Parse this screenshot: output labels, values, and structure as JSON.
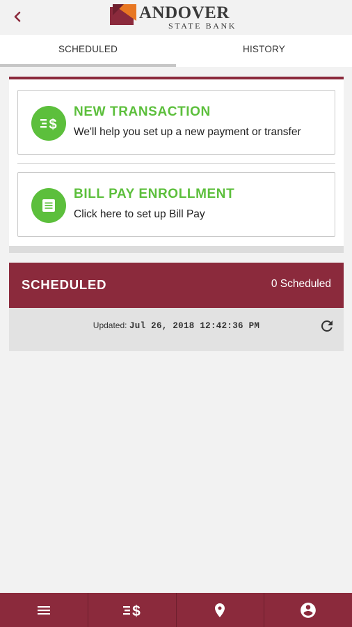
{
  "header": {
    "back_icon": "chevron-left-icon",
    "logo_line1": "ANDOVER",
    "logo_line2": "STATE BANK"
  },
  "tabs": [
    {
      "label": "SCHEDULED",
      "active": true
    },
    {
      "label": "HISTORY",
      "active": false
    }
  ],
  "actions": {
    "new_transaction": {
      "title": "NEW TRANSACTION",
      "subtitle": "We'll help you set up a new payment or transfer",
      "icon": "transfer-money-icon"
    },
    "bill_pay": {
      "title": "BILL PAY ENROLLMENT",
      "subtitle": "Click here to set up Bill Pay",
      "icon": "document-icon"
    }
  },
  "scheduled": {
    "title": "SCHEDULED",
    "count_label": "0 Scheduled",
    "updated_label": "Updated:",
    "updated_value": "Jul 26, 2018 12:42:36 PM",
    "refresh_icon": "refresh-icon"
  },
  "bottom_nav": [
    {
      "icon": "menu-icon"
    },
    {
      "icon": "transfer-money-icon"
    },
    {
      "icon": "location-pin-icon"
    },
    {
      "icon": "account-icon"
    }
  ],
  "colors": {
    "brand": "#8b2a3c",
    "accent_green": "#5cbf3c",
    "logo_orange": "#e87722"
  }
}
